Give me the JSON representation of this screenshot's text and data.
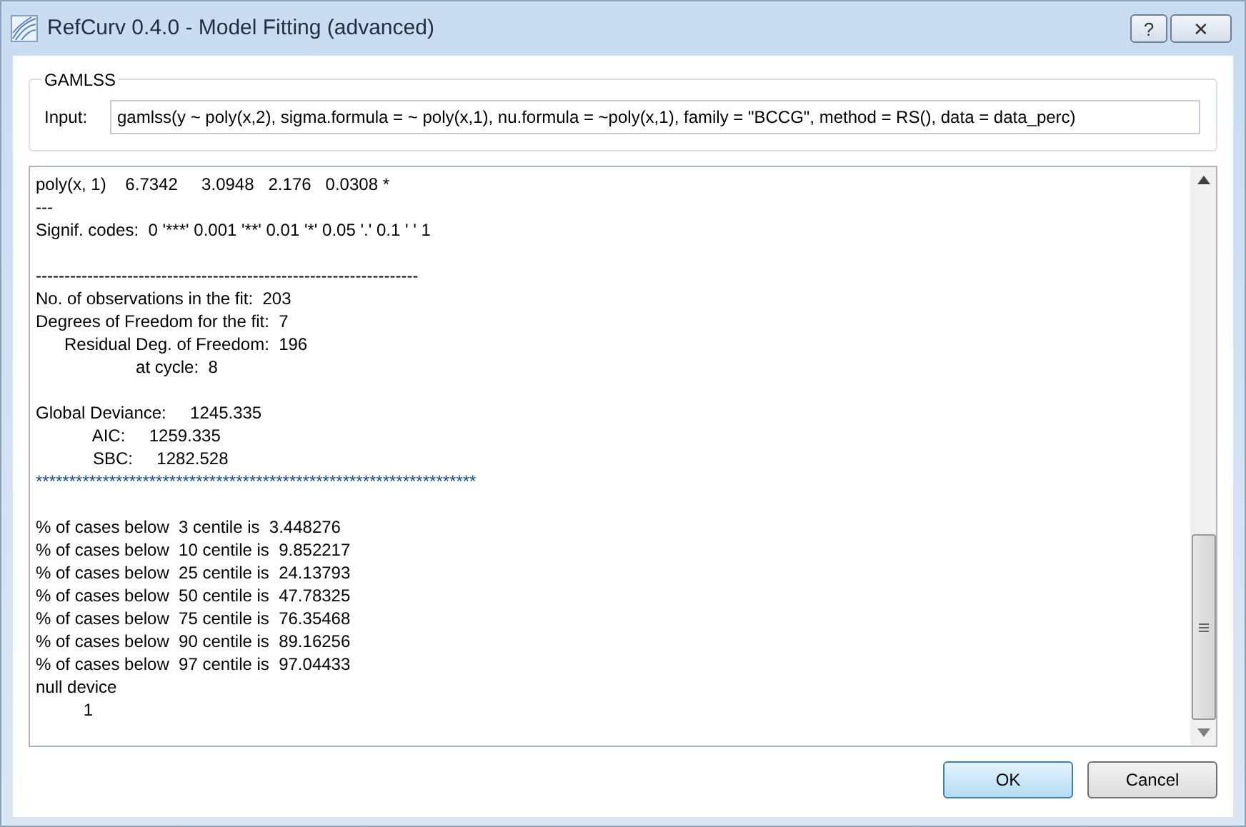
{
  "window": {
    "title": "RefCurv 0.4.0 - Model Fitting (advanced)",
    "buttons": [
      {
        "kind": "help",
        "label": "?"
      },
      {
        "kind": "close",
        "label": "✕"
      }
    ]
  },
  "group": {
    "title": "GAMLSS",
    "input_label": "Input:",
    "input_value": "gamlss(y ~ poly(x,2), sigma.formula = ~ poly(x,1), nu.formula = ~poly(x,1), family = \"BCCG\", method = RS(), data = data_perc)"
  },
  "output": {
    "blocks": [
      [
        {
          "text": "poly(x, 1)    6.7342     3.0948   2.176   0.0308 *",
          "color": "#000000"
        },
        {
          "text": "---",
          "color": "#000000"
        },
        {
          "text": "Signif. codes:  0 '***' 0.001 '**' 0.01 '*' 0.05 '.' 0.1 ' ' 1",
          "color": "#000000"
        }
      ],
      [
        {
          "text": "-------------------------------------------------------------------",
          "color": "#000000"
        },
        {
          "text": "No. of observations in the fit:  203",
          "color": "#000000"
        },
        {
          "text": "Degrees of Freedom for the fit:  7",
          "color": "#000000"
        },
        {
          "text": "      Residual Deg. of Freedom:  196",
          "color": "#000000"
        },
        {
          "text": "                     at cycle:  8",
          "color": "#000000"
        }
      ],
      [
        {
          "text": "Global Deviance:     1245.335",
          "color": "#000000"
        },
        {
          "text": "            AIC:     1259.335",
          "color": "#000000"
        },
        {
          "text": "            SBC:     1282.528",
          "color": "#000000"
        },
        {
          "text": "******************************************************************",
          "color": "#1a4f8f"
        }
      ],
      [
        {
          "text": "% of cases below  3 centile is  3.448276",
          "color": "#000000"
        },
        {
          "text": "% of cases below  10 centile is  9.852217",
          "color": "#000000"
        },
        {
          "text": "% of cases below  25 centile is  24.13793",
          "color": "#000000"
        },
        {
          "text": "% of cases below  50 centile is  47.78325",
          "color": "#000000"
        },
        {
          "text": "% of cases below  75 centile is  76.35468",
          "color": "#000000"
        },
        {
          "text": "% of cases below  90 centile is  89.16256",
          "color": "#000000"
        },
        {
          "text": "% of cases below  97 centile is  97.04433",
          "color": "#000000"
        },
        {
          "text": "null device",
          "color": "#000000"
        },
        {
          "text": "          1",
          "color": "#000000"
        }
      ]
    ]
  },
  "buttons": [
    {
      "label": "OK",
      "default": true
    },
    {
      "label": "Cancel",
      "default": false
    }
  ]
}
